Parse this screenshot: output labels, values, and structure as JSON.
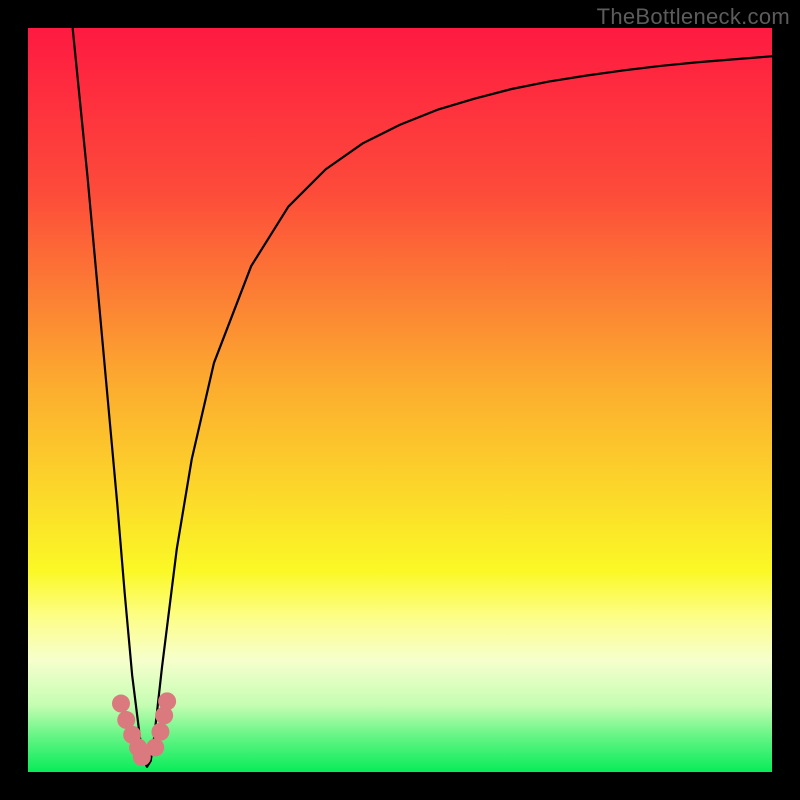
{
  "brand": "TheBottleneck.com",
  "chart_data": {
    "type": "line",
    "title": "",
    "xlabel": "",
    "ylabel": "",
    "xlim": [
      0,
      100
    ],
    "ylim": [
      0,
      100
    ],
    "grid": false,
    "note": "Values estimated from curve shape; axes are unlabeled.",
    "series": [
      {
        "name": "curve",
        "x": [
          6,
          8,
          10,
          12,
          13,
          14,
          15,
          15.5,
          16,
          16.5,
          17,
          18,
          19,
          20,
          22,
          25,
          30,
          35,
          40,
          45,
          50,
          55,
          60,
          65,
          70,
          75,
          80,
          85,
          90,
          95,
          100
        ],
        "y": [
          100,
          80,
          58,
          36,
          24,
          13,
          5,
          1.5,
          0.7,
          1.5,
          5,
          14,
          22,
          30,
          42,
          55,
          68,
          76,
          81,
          84.5,
          87,
          89,
          90.5,
          91.8,
          92.8,
          93.6,
          94.3,
          94.9,
          95.4,
          95.8,
          96.2
        ]
      },
      {
        "name": "minimum-markers",
        "x": [
          12.5,
          13.2,
          14.0,
          14.8,
          15.3,
          17.1,
          17.8,
          18.3,
          18.7
        ],
        "y": [
          9.2,
          7.0,
          5.0,
          3.3,
          2.0,
          3.3,
          5.4,
          7.6,
          9.5
        ]
      }
    ],
    "gradient_stops": [
      {
        "pct": 0,
        "color": "#fe1a41"
      },
      {
        "pct": 22,
        "color": "#fd4b3a"
      },
      {
        "pct": 48,
        "color": "#fcac2f"
      },
      {
        "pct": 73,
        "color": "#fbf826"
      },
      {
        "pct": 79,
        "color": "#fdfe85"
      },
      {
        "pct": 85,
        "color": "#f6ffcd"
      },
      {
        "pct": 91,
        "color": "#c5fdb2"
      },
      {
        "pct": 95,
        "color": "#69f587"
      },
      {
        "pct": 100,
        "color": "#07ec58"
      }
    ],
    "marker_color": "#db7a7e",
    "curve_color": "#000000"
  }
}
